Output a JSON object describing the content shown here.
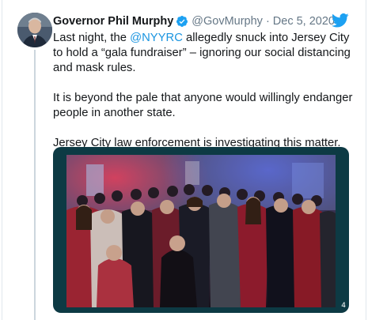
{
  "tweet": {
    "display_name": "Governor Phil Murphy",
    "handle": "@GovMurphy",
    "separator": "·",
    "date": "Dec 5, 2020",
    "text": {
      "p1_prefix": "Last night, the ",
      "p1_mention": "@NYYRC",
      "p1_suffix": " allegedly snuck into Jersey City to hold a “gala fundraiser” – ignoring our social distancing and mask rules.",
      "p2": "It is beyond the pale that anyone would willingly endanger people in another state.",
      "p3": "Jersey City law enforcement is investigating this matter."
    },
    "media": {
      "counter": "4"
    }
  },
  "icons": {
    "verified": "verified-badge-icon",
    "brand": "twitter-bird-icon"
  },
  "colors": {
    "link": "#1b95e0",
    "secondary_text": "#657786",
    "twitter_blue": "#1da1f2",
    "media_frame": "#0d3a44"
  }
}
